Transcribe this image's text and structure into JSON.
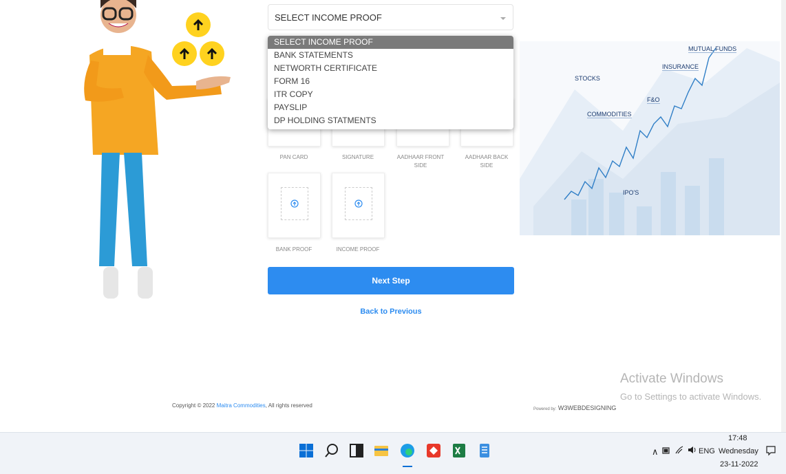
{
  "income_proof_select": {
    "value": "SELECT INCOME PROOF",
    "options": [
      "SELECT INCOME PROOF",
      "BANK STATEMENTS",
      "NETWORTH CERTIFICATE",
      "FORM 16",
      "ITR COPY",
      "PAYSLIP",
      "DP HOLDING STATMENTS"
    ]
  },
  "uploads": {
    "pan_card": "PAN CARD",
    "signature": "SIGNATURE",
    "aadhaar_front": "AADHAAR FRONT SIDE",
    "aadhaar_back": "AADHAAR BACK SIDE",
    "bank_proof": "BANK PROOF",
    "income_proof": "INCOME PROOF"
  },
  "actions": {
    "next": "Next Step",
    "back": "Back to Previous"
  },
  "market_labels": {
    "mutual_funds": "MUTUAL FUNDS",
    "insurance": "INSURANCE",
    "stocks": "STOCKS",
    "fno": "F&O",
    "commodities": "COMMODITIES",
    "ipos": "IPO'S"
  },
  "footer": {
    "copyright_prefix": "Copyright © 2022",
    "company": "Maitra Commodities",
    "copyright_suffix": ", All rights reserved",
    "powered_by": "Powered by:",
    "powered_name": "W3WEBDESIGNING"
  },
  "watermark": {
    "line1": "Activate Windows",
    "line2": "Go to Settings to activate Windows."
  },
  "taskbar": {
    "icons": [
      "windows-start-icon",
      "search-icon",
      "task-view-icon",
      "file-explorer-icon",
      "edge-icon",
      "anydesk-icon",
      "excel-icon",
      "notepad-icon"
    ],
    "lang": "ENG",
    "time": "17:48",
    "day": "Wednesday",
    "date": "23-11-2022"
  }
}
